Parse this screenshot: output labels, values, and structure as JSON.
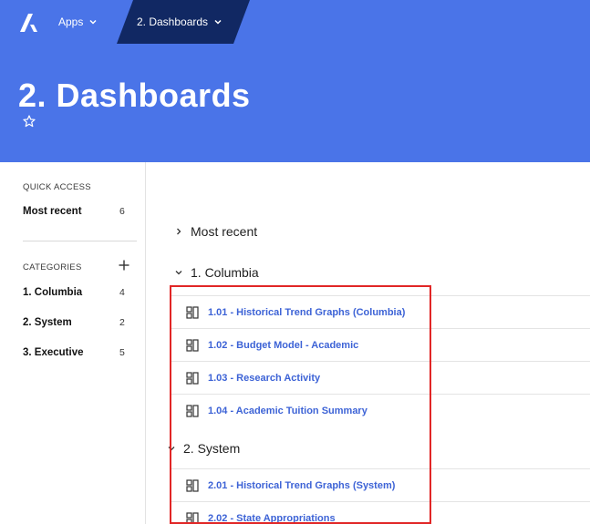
{
  "topbar": {
    "apps_label": "Apps",
    "breadcrumb_label": "2. Dashboards"
  },
  "page": {
    "title": "2. Dashboards"
  },
  "sidebar": {
    "quick_access_label": "QUICK ACCESS",
    "quick_access": [
      {
        "label": "Most recent",
        "count": "6"
      }
    ],
    "categories_label": "CATEGORIES",
    "categories": [
      {
        "label": "1. Columbia",
        "count": "4"
      },
      {
        "label": "2. System",
        "count": "2"
      },
      {
        "label": "3. Executive",
        "count": "5"
      }
    ]
  },
  "main": {
    "groups": [
      {
        "label": "Most recent",
        "expanded": false
      },
      {
        "label": "1. Columbia",
        "expanded": true,
        "items": [
          "1.01 - Historical Trend Graphs (Columbia)",
          "1.02 - Budget Model - Academic",
          "1.03 - Research Activity",
          "1.04 - Academic Tuition Summary"
        ]
      },
      {
        "label": "2. System",
        "expanded": true,
        "items": [
          "2.01 - Historical Trend Graphs (System)",
          "2.02 - State Appropriations"
        ]
      }
    ]
  },
  "colors": {
    "header_bg": "#4a74e8",
    "breadcrumb_active_bg": "#112863",
    "link": "#3d63d6",
    "highlight_border": "#e12626"
  },
  "icons": [
    "logo-icon",
    "chevron-down-icon",
    "star-outline-icon",
    "plus-icon",
    "chevron-right-icon",
    "dashboard-icon"
  ]
}
